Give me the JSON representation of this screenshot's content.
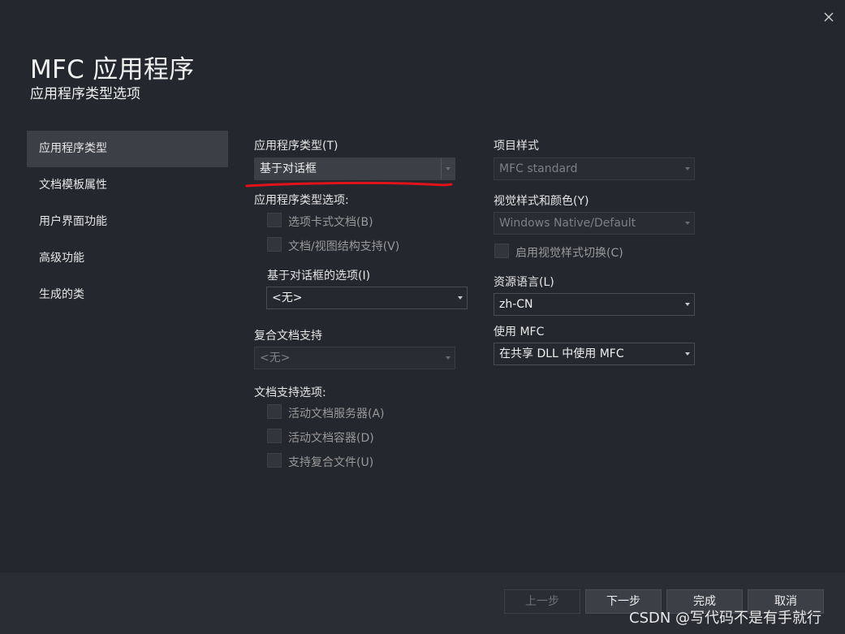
{
  "window": {
    "title": "MFC 应用程序",
    "subtitle": "应用程序类型选项"
  },
  "icons": {
    "close": "close-icon",
    "dropdown": "chevron-down-icon"
  },
  "colors": {
    "background": "#25272e",
    "selected_nav": "#3d3f47",
    "annotation": "#e0121a"
  },
  "sidebar": {
    "items": [
      {
        "label": "应用程序类型",
        "selected": true
      },
      {
        "label": "文档模板属性"
      },
      {
        "label": "用户界面功能"
      },
      {
        "label": "高级功能"
      },
      {
        "label": "生成的类"
      }
    ]
  },
  "left_column": {
    "app_type_label": "应用程序类型(T)",
    "app_type_value": "基于对话框",
    "app_type_options_label": "应用程序类型选项:",
    "tabbed_docs": "选项卡式文档(B)",
    "doc_view_support": "文档/视图结构支持(V)",
    "dialog_options_label": "基于对话框的选项(I)",
    "dialog_options_value": "<无>",
    "compound_doc_label": "复合文档支持",
    "compound_doc_value": "<无>",
    "doc_support_label": "文档支持选项:",
    "active_doc_server": "活动文档服务器(A)",
    "active_doc_container": "活动文档容器(D)",
    "compound_files": "支持复合文件(U)"
  },
  "right_column": {
    "project_style_label": "项目样式",
    "project_style_value": "MFC standard",
    "visual_style_label": "视觉样式和颜色(Y)",
    "visual_style_value": "Windows Native/Default",
    "enable_visual_switch": "启用视觉样式切换(C)",
    "resource_lang_label": "资源语言(L)",
    "resource_lang_value": "zh-CN",
    "use_mfc_label": "使用 MFC",
    "use_mfc_value": "在共享 DLL 中使用 MFC"
  },
  "footer": {
    "prev": "上一步",
    "next": "下一步",
    "finish": "完成",
    "cancel": "取消"
  },
  "watermark": "CSDN @写代码不是有手就行"
}
